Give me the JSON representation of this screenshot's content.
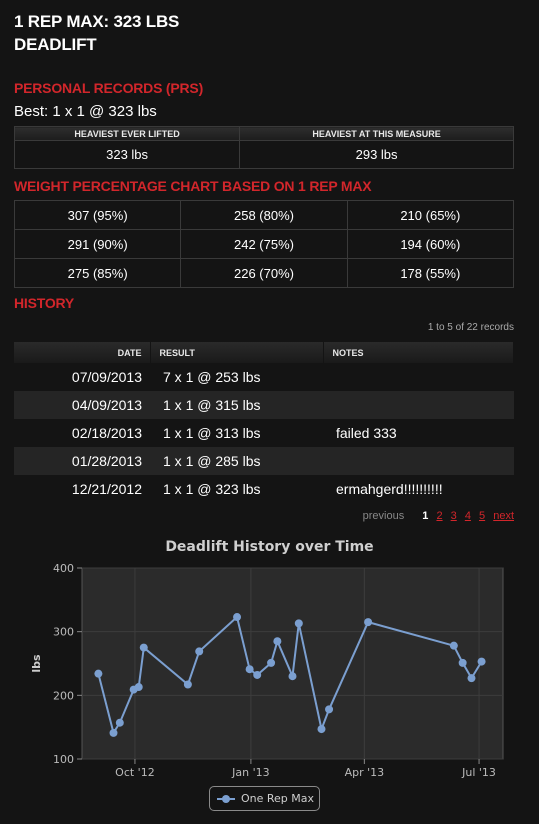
{
  "header": {
    "title_line1": "1 REP MAX: 323 LBS",
    "title_line2": "DEADLIFT"
  },
  "prs": {
    "heading": "PERSONAL RECORDS (PRS)",
    "best": "Best: 1 x 1 @ 323 lbs",
    "columns": [
      "HEAVIEST EVER LIFTED",
      "HEAVIEST AT THIS MEASURE"
    ],
    "values": [
      "323 lbs",
      "293 lbs"
    ]
  },
  "percentages": {
    "heading": "WEIGHT PERCENTAGE CHART BASED ON 1 REP MAX",
    "rows": [
      [
        "307 (95%)",
        "258 (80%)",
        "210 (65%)"
      ],
      [
        "291 (90%)",
        "242 (75%)",
        "194 (60%)"
      ],
      [
        "275 (85%)",
        "226 (70%)",
        "178 (55%)"
      ]
    ]
  },
  "history": {
    "heading": "HISTORY",
    "records_info": "1 to 5 of 22 records",
    "columns": {
      "date": "DATE",
      "result": "RESULT",
      "notes": "NOTES"
    },
    "rows": [
      {
        "date": "07/09/2013",
        "result": "7 x 1 @ 253 lbs",
        "notes": ""
      },
      {
        "date": "04/09/2013",
        "result": "1 x 1 @ 315 lbs",
        "notes": ""
      },
      {
        "date": "02/18/2013",
        "result": "1 x 1 @ 313 lbs",
        "notes": "failed 333"
      },
      {
        "date": "01/28/2013",
        "result": "1 x 1 @ 285 lbs",
        "notes": ""
      },
      {
        "date": "12/21/2012",
        "result": "1 x 1 @ 323 lbs",
        "notes": "ermahgerd!!!!!!!!!!"
      }
    ],
    "pager": {
      "previous": "previous",
      "pages": [
        "1",
        "2",
        "3",
        "4",
        "5"
      ],
      "current": "1",
      "next": "next"
    }
  },
  "colors": {
    "accent": "#d2262b",
    "series": "#7b9fd0",
    "plot_bg": "#2b2b2b"
  },
  "chart_data": {
    "type": "line",
    "title": "Deadlift History over Time",
    "ylabel": "lbs",
    "xlabel": "",
    "ylim": [
      100,
      400
    ],
    "yticks": [
      100,
      200,
      300,
      400
    ],
    "xlim": [
      "2012-08-20",
      "2013-07-20"
    ],
    "xticks": [
      {
        "date": "2012-10-01",
        "label": "Oct '12"
      },
      {
        "date": "2013-01-01",
        "label": "Jan '13"
      },
      {
        "date": "2013-04-01",
        "label": "Apr '13"
      },
      {
        "date": "2013-07-01",
        "label": "Jul '13"
      }
    ],
    "grid": true,
    "legend": "bottom-center",
    "series": [
      {
        "name": "One Rep Max",
        "points": [
          [
            "2012-09-02",
            234
          ],
          [
            "2012-09-14",
            141
          ],
          [
            "2012-09-19",
            157
          ],
          [
            "2012-09-30",
            209
          ],
          [
            "2012-10-04",
            213
          ],
          [
            "2012-10-08",
            275
          ],
          [
            "2012-11-12",
            217
          ],
          [
            "2012-11-21",
            269
          ],
          [
            "2012-12-21",
            323
          ],
          [
            "2012-12-31",
            241
          ],
          [
            "2013-01-06",
            232
          ],
          [
            "2013-01-17",
            251
          ],
          [
            "2013-01-22",
            285
          ],
          [
            "2013-02-03",
            230
          ],
          [
            "2013-02-08",
            313
          ],
          [
            "2013-02-26",
            147
          ],
          [
            "2013-03-04",
            178
          ],
          [
            "2013-04-04",
            315
          ],
          [
            "2013-06-11",
            278
          ],
          [
            "2013-06-18",
            251
          ],
          [
            "2013-06-25",
            227
          ],
          [
            "2013-07-03",
            253
          ]
        ]
      }
    ]
  }
}
